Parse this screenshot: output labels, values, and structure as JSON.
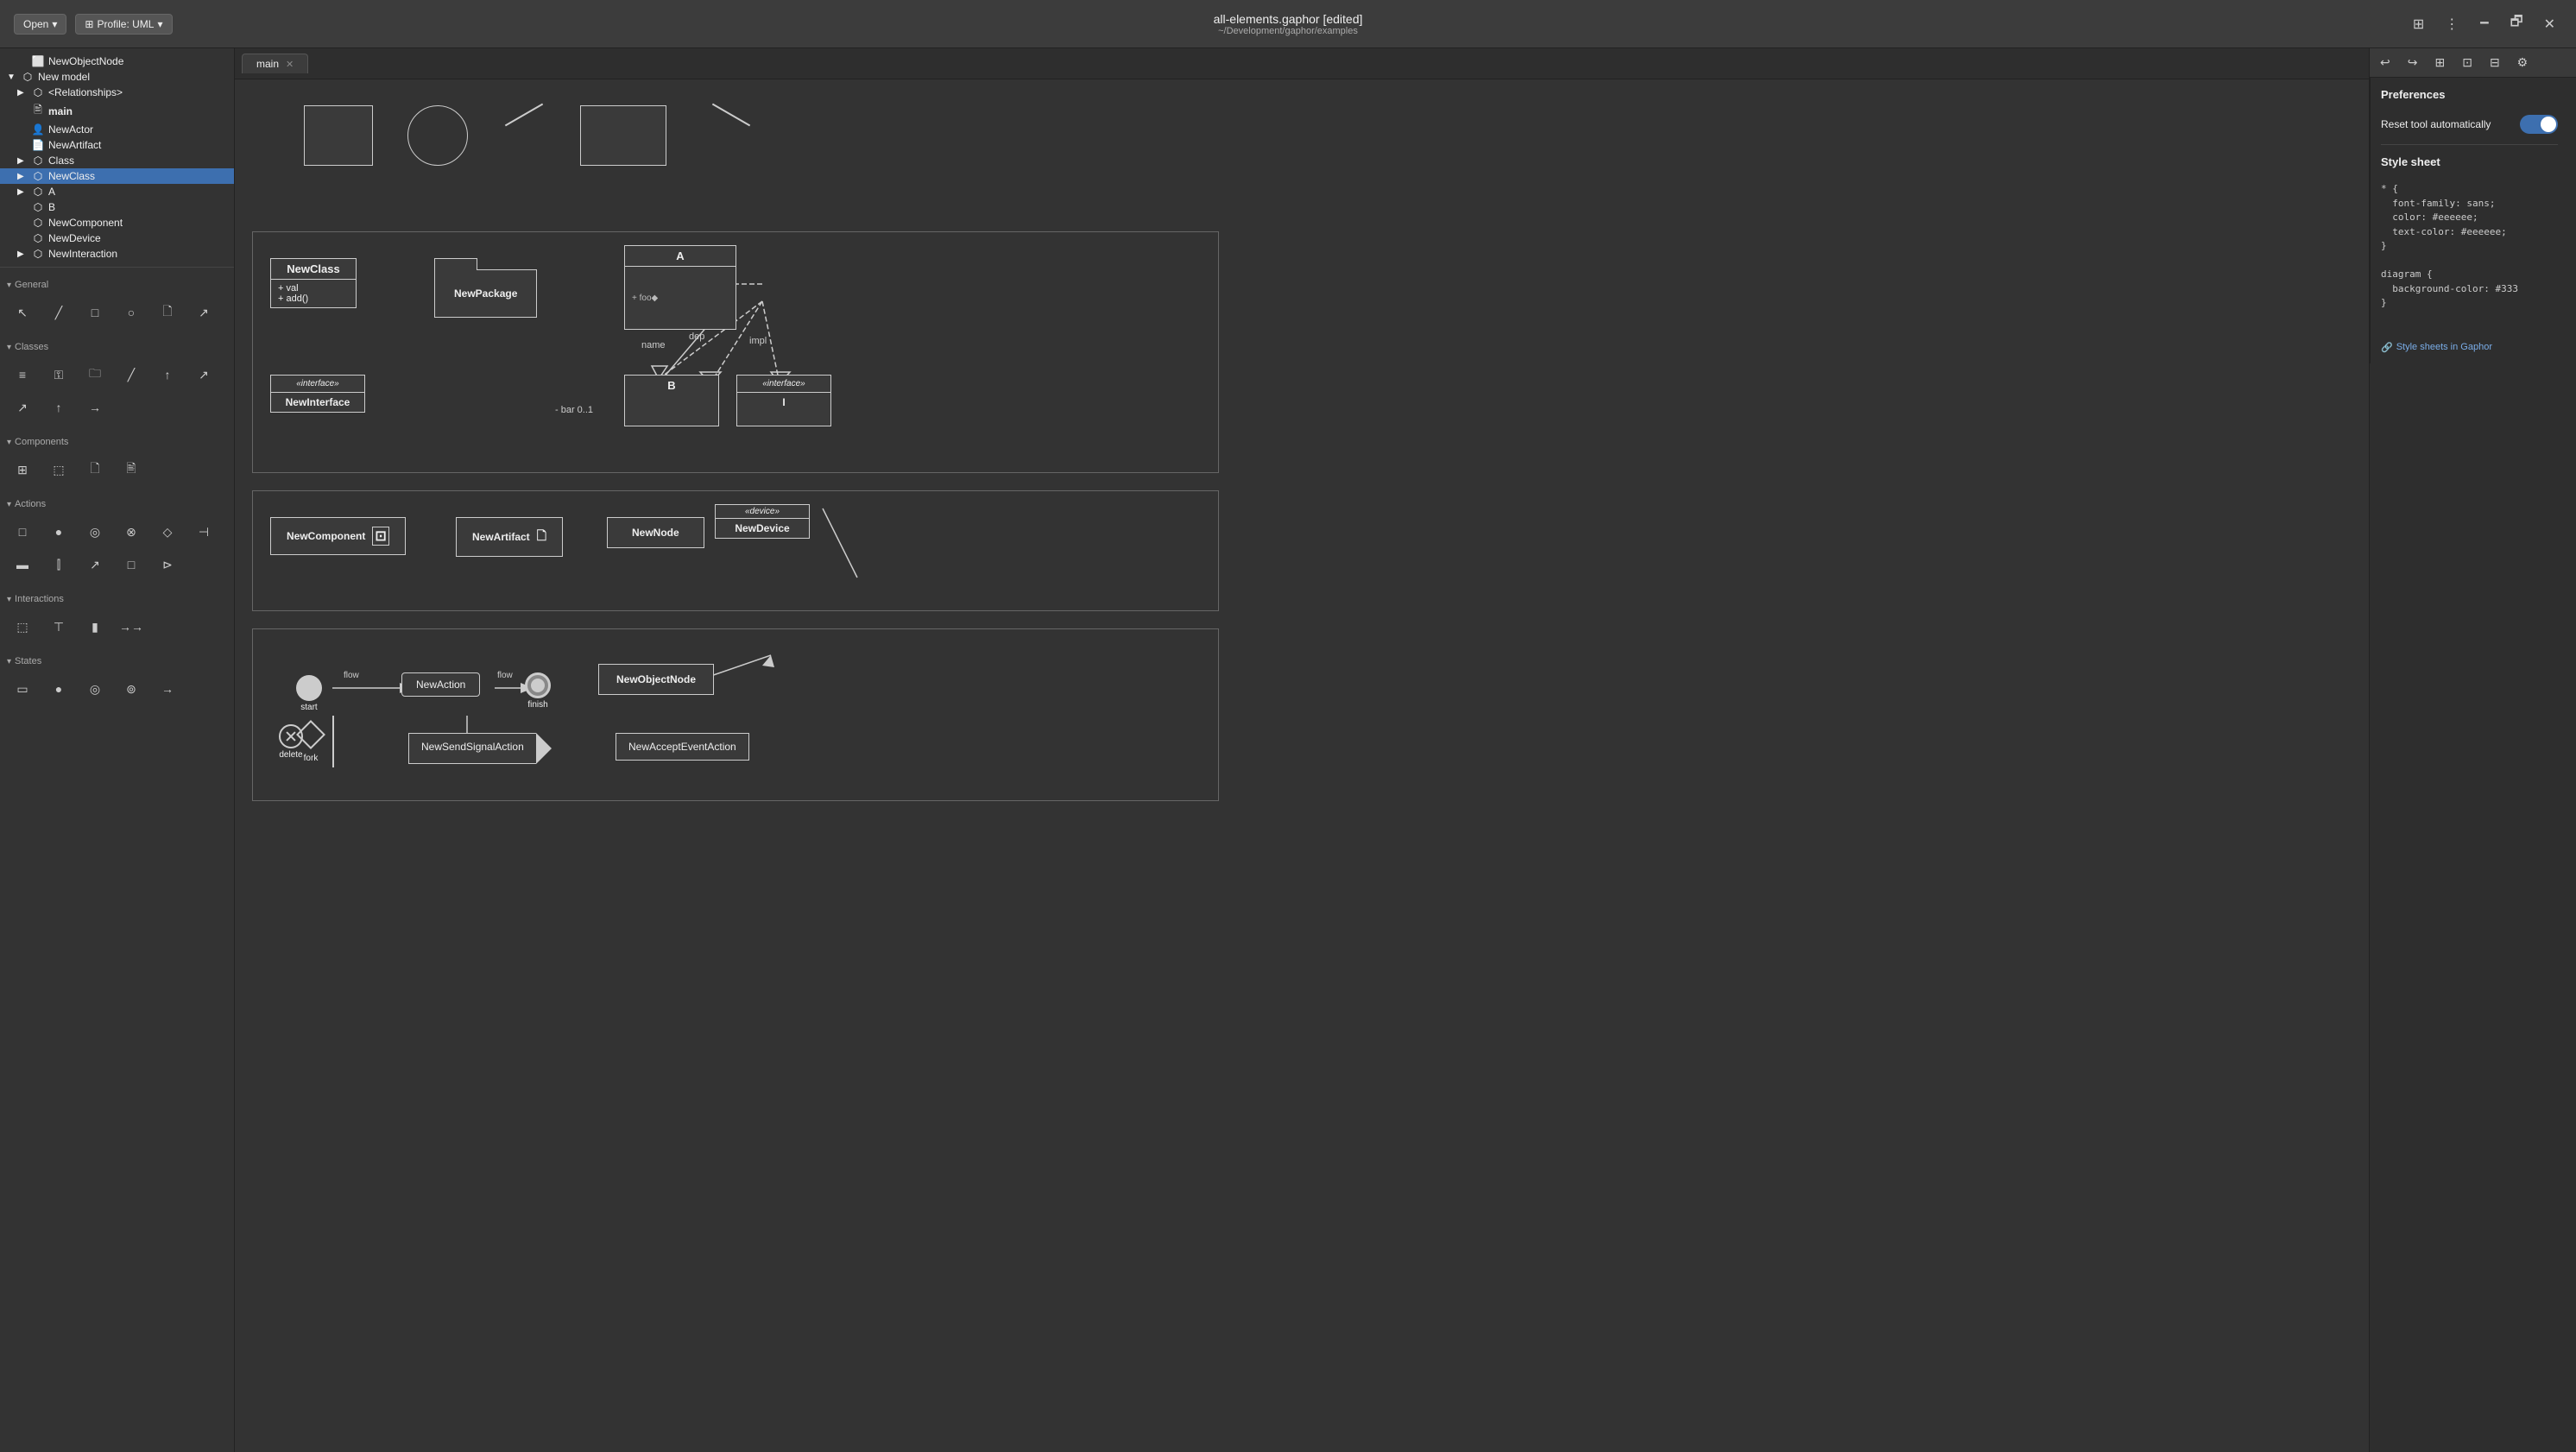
{
  "topbar": {
    "open_label": "Open",
    "profile_label": "Profile: UML",
    "title": "all-elements.gaphor [edited]",
    "subtitle": "~/Development/gaphor/examples"
  },
  "tabs": [
    {
      "label": "main",
      "active": true
    }
  ],
  "tree": {
    "items": [
      {
        "id": "new-object-node",
        "label": "NewObjectNode",
        "indent": 1,
        "icon": "⬜",
        "expanded": false
      },
      {
        "id": "new-model",
        "label": "New model",
        "indent": 0,
        "icon": "▼",
        "expanded": true
      },
      {
        "id": "relationships",
        "label": "<Relationships>",
        "indent": 1,
        "icon": "▶",
        "expanded": false
      },
      {
        "id": "main-item",
        "label": "main",
        "indent": 1,
        "icon": "🖹",
        "bold": true
      },
      {
        "id": "new-actor",
        "label": "NewActor",
        "indent": 1,
        "icon": "👤"
      },
      {
        "id": "new-artifact",
        "label": "NewArtifact",
        "indent": 1,
        "icon": "📄"
      },
      {
        "id": "class",
        "label": "Class",
        "indent": 1,
        "icon": "▶",
        "expanded": false
      },
      {
        "id": "new-class",
        "label": "NewClass",
        "indent": 1,
        "icon": "▶",
        "expanded": false,
        "selected": true
      },
      {
        "id": "a",
        "label": "A",
        "indent": 1,
        "icon": "▶"
      },
      {
        "id": "b",
        "label": "B",
        "indent": 1,
        "icon": "⬜"
      },
      {
        "id": "new-component",
        "label": "NewComponent",
        "indent": 1,
        "icon": "⬜"
      },
      {
        "id": "new-device",
        "label": "NewDevice",
        "indent": 1,
        "icon": "⬜"
      },
      {
        "id": "new-interaction",
        "label": "NewInteraction",
        "indent": 1,
        "icon": "▶"
      }
    ]
  },
  "tools": {
    "general_label": "General",
    "classes_label": "Classes",
    "components_label": "Components",
    "actions_label": "Actions",
    "interactions_label": "Interactions",
    "states_label": "States"
  },
  "diagram": {
    "class_box": {
      "name": "NewClass",
      "attrs": [
        "+ val",
        "+ add()"
      ]
    },
    "package_box": {
      "name": "NewPackage"
    },
    "interface_box": {
      "stereotype": "«interface»",
      "name": "NewInterface"
    },
    "class_a": {
      "name": "A"
    },
    "class_b": {
      "name": "B"
    },
    "interface_i": {
      "stereotype": "«interface»",
      "name": "I"
    },
    "component_box": {
      "name": "NewComponent"
    },
    "artifact_box": {
      "name": "NewArtifact"
    },
    "node_box": {
      "name": "NewNode"
    },
    "device_box": {
      "stereotype": "«device»",
      "name": "NewDevice"
    },
    "action_start": "start",
    "action_name": "NewAction",
    "action_finish": "finish",
    "object_node": "NewObjectNode",
    "send_signal": "NewSendSignalAction",
    "accept_event": "NewAcceptEventAction",
    "action_delete": "delete",
    "action_fork": "fork",
    "flow_label1": "flow",
    "flow_label2": "flow",
    "assoc_name": "name",
    "assoc_dep": "dep",
    "assoc_impl": "impl",
    "assoc_bar": "- bar  0..1"
  },
  "right_panel": {
    "title": "Preferences",
    "reset_tool_label": "Reset tool automatically",
    "style_sheet_label": "Style sheet",
    "style_code": "* {\n  font-family: sans;\n  color: #eeeeee;\n  text-color: #eeeeee;\n}\n\ndiagram {\n  background-color: #333\n}",
    "style_link": "Style sheets in Gaphor"
  }
}
